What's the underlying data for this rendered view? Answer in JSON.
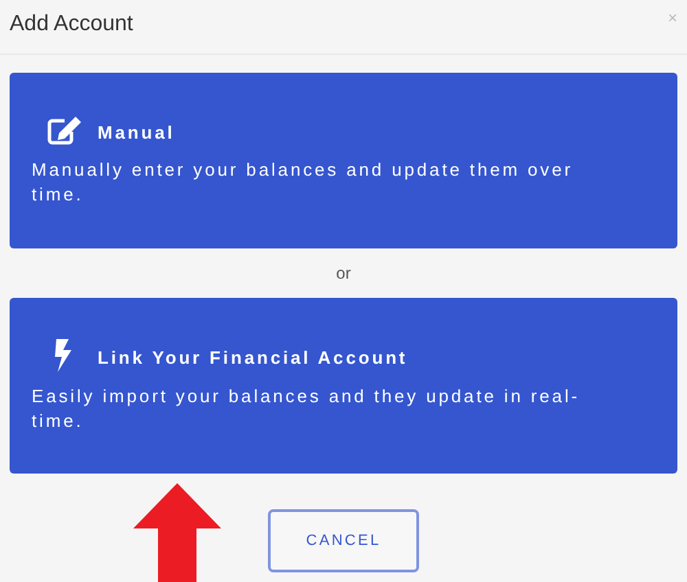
{
  "dialog": {
    "title": "Add Account",
    "close": "×"
  },
  "options": [
    {
      "kind": "manual",
      "title": "Manual",
      "description": "Manually enter your balances and update them over time."
    },
    {
      "kind": "link",
      "title": "Link Your Financial Account",
      "description": "Easily import your balances and they update in real-time."
    }
  ],
  "separator": "or",
  "buttons": [
    "CANCEL"
  ]
}
